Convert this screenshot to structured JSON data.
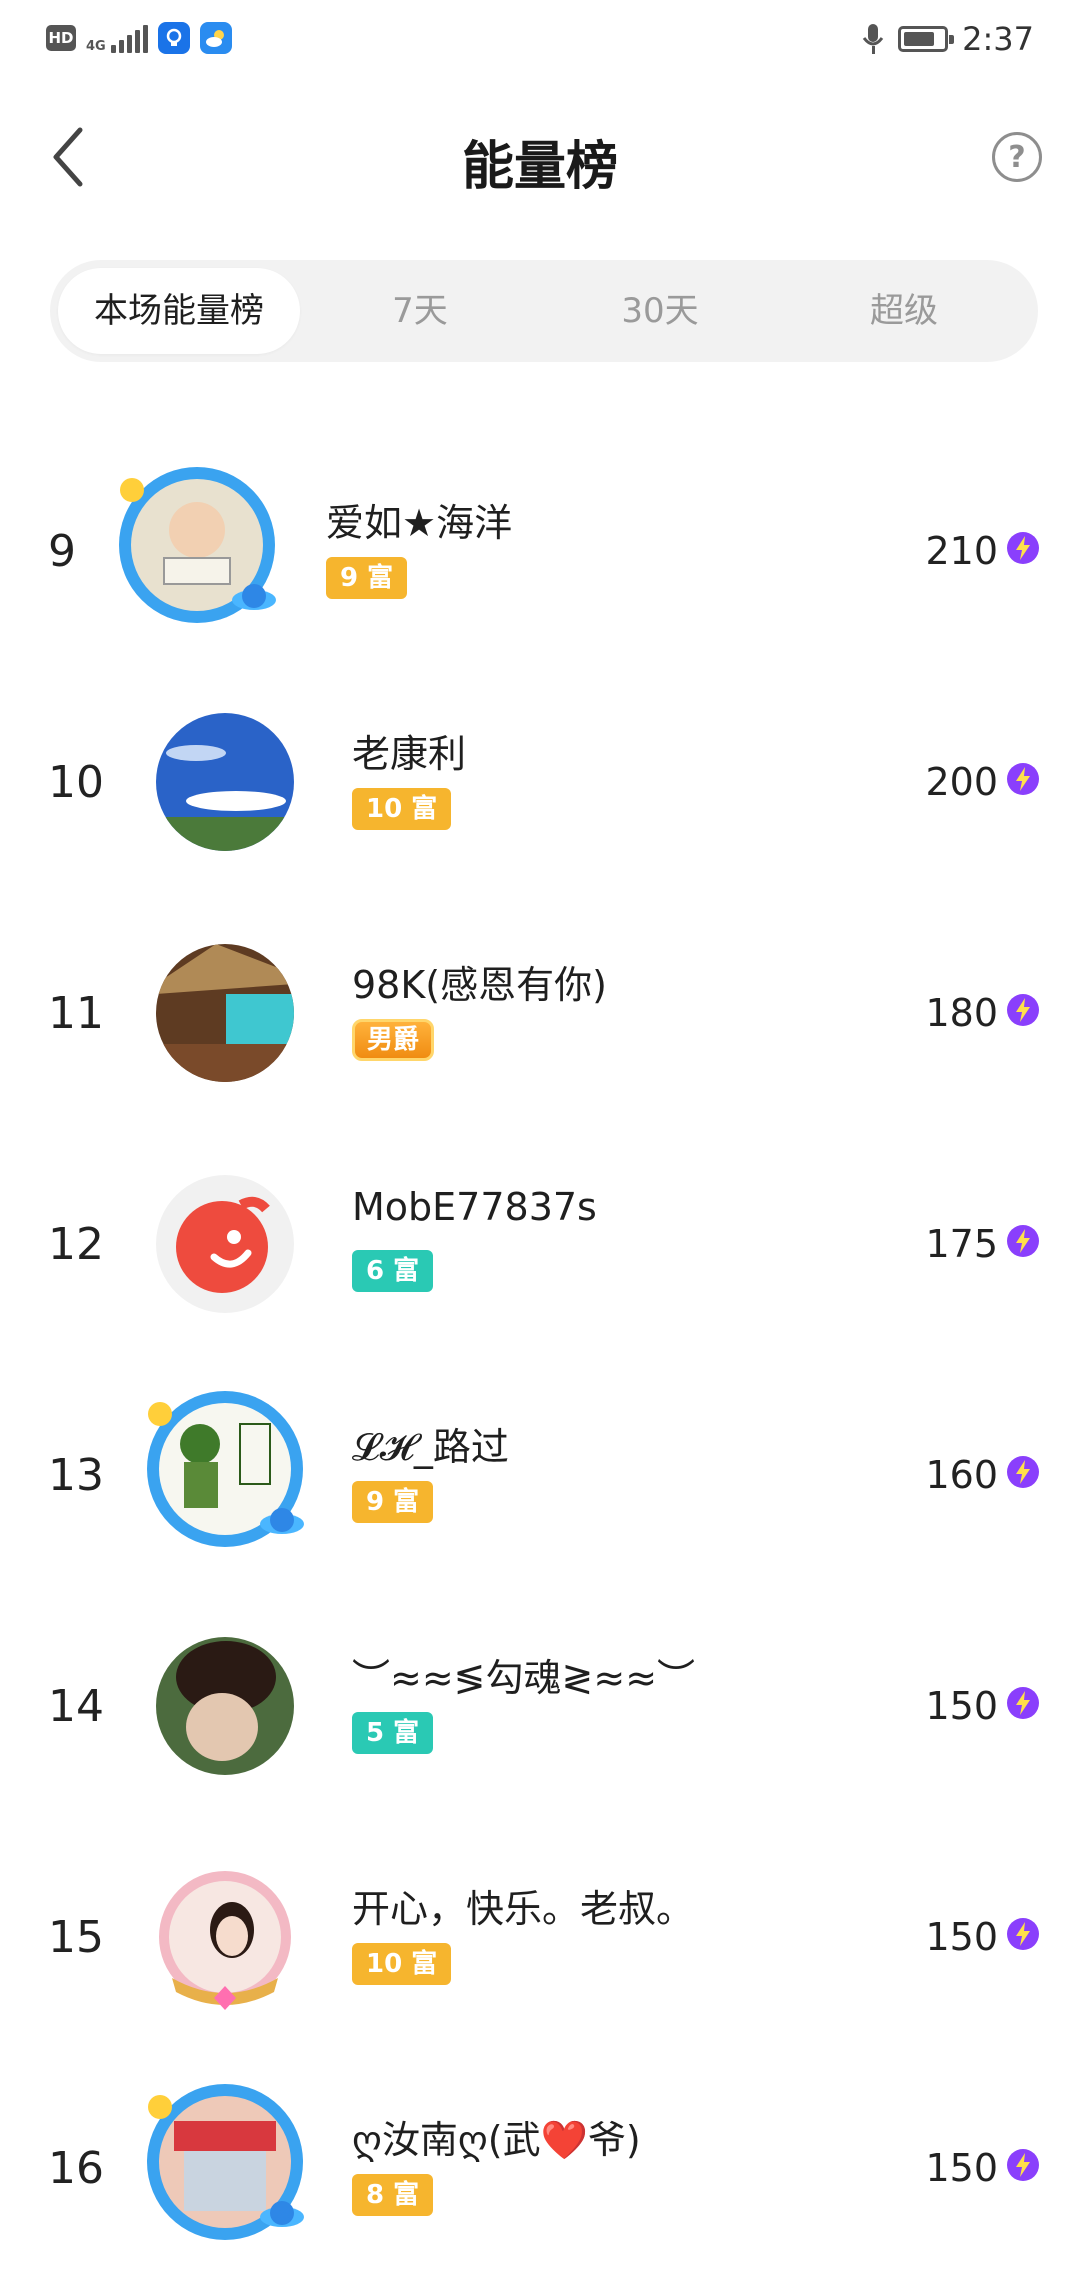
{
  "status_bar": {
    "hd": "HD",
    "network": "4G",
    "time": "2:37"
  },
  "header": {
    "title": "能量榜",
    "back_icon": "chevron-left-icon",
    "help_icon": "question-circle-icon",
    "help_symbol": "?"
  },
  "tabs": [
    {
      "label": "本场能量榜",
      "active": true
    },
    {
      "label": "7天",
      "active": false
    },
    {
      "label": "30天",
      "active": false
    },
    {
      "label": "超级",
      "active": false
    }
  ],
  "list": [
    {
      "rank": "9",
      "name": "爱如★海洋",
      "badge": "9 富",
      "badge_color": "#f6b52e",
      "score": "210"
    },
    {
      "rank": "10",
      "name": "老康利",
      "badge": "10 富",
      "badge_color": "#f6b52e",
      "score": "200"
    },
    {
      "rank": "11",
      "name": "98K(感恩有你)",
      "badge": "男爵",
      "badge_color": "#f08c12",
      "score": "180"
    },
    {
      "rank": "12",
      "name": "MobE77837s",
      "badge": "6 富",
      "badge_color": "#2ac9b4",
      "score": "175"
    },
    {
      "rank": "13",
      "name": "𝓛𝓗_路过",
      "badge": "9 富",
      "badge_color": "#f6b52e",
      "score": "160"
    },
    {
      "rank": "14",
      "name": "︶≈≈≶勾魂≷≈≈︶",
      "badge": "5 富",
      "badge_color": "#2ac9b4",
      "score": "150"
    },
    {
      "rank": "15",
      "name": "开心，快乐。老叔。",
      "badge": "10 富",
      "badge_color": "#f6b52e",
      "score": "150"
    },
    {
      "rank": "16",
      "name": "ღ汝南ღ(武❤️爷)",
      "badge": "8 富",
      "badge_color": "#f6b52e",
      "score": "150"
    }
  ],
  "score_icon": "energy-bolt-icon",
  "colors": {
    "accent_purple": "#8a3ffc",
    "tab_bg": "#f2f2f2",
    "badge_orange": "#f6b52e",
    "badge_teal": "#2ac9b4"
  }
}
